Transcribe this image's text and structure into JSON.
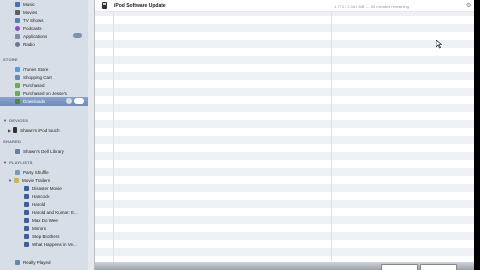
{
  "sidebar": {
    "library": [
      {
        "label": "Music",
        "color": "#4a6fb5"
      },
      {
        "label": "Movies",
        "color": "#5f5f5f"
      },
      {
        "label": "TV Shows",
        "color": "#5b7fb0"
      },
      {
        "label": "Podcasts",
        "color": "#8a4fb8"
      },
      {
        "label": "Applications",
        "color": "#7a8fa8"
      },
      {
        "label": "Radio",
        "color": "#6c7a8a"
      }
    ],
    "store_header": "STORE",
    "store": [
      {
        "label": "iTunes Store",
        "color": "#5c9bd6"
      },
      {
        "label": "Shopping Cart",
        "color": "#6a8ab0"
      },
      {
        "label": "Purchased",
        "color": "#6faa5a"
      },
      {
        "label": "Purchased on Jesse's",
        "color": "#6faa5a"
      },
      {
        "label": "Downloads",
        "color": "#4f8a3c"
      }
    ],
    "devices_header": "DEVICES",
    "devices": [
      {
        "label": "Shawn's iPod touch",
        "color": "#333333"
      }
    ],
    "shared_header": "SHARED",
    "shared": [
      {
        "label": "Shawn's Dell Library",
        "color": "#6a7f99"
      }
    ],
    "playlists_header": "PLAYLISTS",
    "playlists": [
      {
        "label": "Party Shuffle",
        "color": "#7a9ac0"
      },
      {
        "label": "Movie Trailers",
        "color": "#d7b24a",
        "folder": true
      },
      {
        "label": "Disaster Movie",
        "color": "#3d5f99",
        "child": true
      },
      {
        "label": "Hancock",
        "color": "#3d5f99",
        "child": true
      },
      {
        "label": "Harold",
        "color": "#3d5f99",
        "child": true
      },
      {
        "label": "Harold and Kumar: E...",
        "color": "#3d5f99",
        "child": true
      },
      {
        "label": "Max Do Wee",
        "color": "#3d5f99",
        "child": true
      },
      {
        "label": "Mirrors",
        "color": "#3d5f99",
        "child": true
      },
      {
        "label": "Step Brothers",
        "color": "#3d5f99",
        "child": true
      },
      {
        "label": "What Happens in Ve...",
        "color": "#3d5f99",
        "child": true
      },
      {
        "label": "Really Played",
        "color": "#6d86a8"
      }
    ]
  },
  "main": {
    "row_title": "iPod Software Update",
    "row_status": "1,770 / 2,341 MB — 55 minutes remaining",
    "gear": "⚙"
  },
  "icons": {
    "update_row": "ipod-icon",
    "progress_action": "gear-icon",
    "pointer": "mouse-pointer-icon"
  },
  "colors": {
    "selection": "#7590ba",
    "sidebar_bg": "#d8dee7",
    "row_stripe": "#edf1f5"
  }
}
